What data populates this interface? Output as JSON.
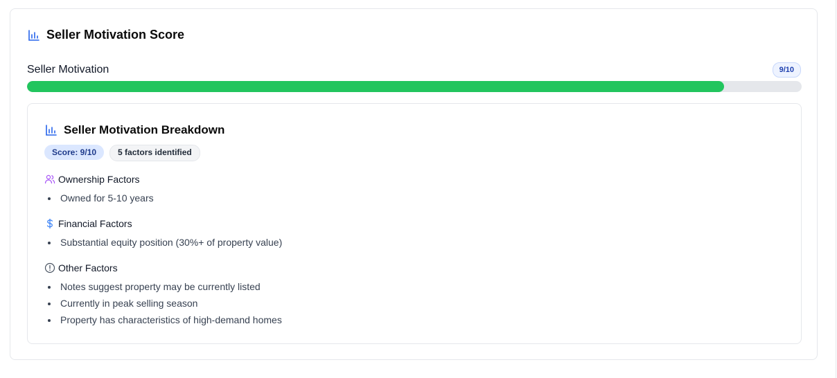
{
  "card": {
    "title": "Seller Motivation Score",
    "icon": "bar-chart-icon"
  },
  "meter": {
    "label": "Seller Motivation",
    "badge": "9/10",
    "value": 9,
    "max": 10,
    "fill_color": "#22c55e"
  },
  "breakdown": {
    "title": "Seller Motivation Breakdown",
    "score_pill": "Score: 9/10",
    "factors_pill": "5 factors identified",
    "sections": [
      {
        "title": "Ownership Factors",
        "icon": "users-icon",
        "items": [
          "Owned for 5-10 years"
        ]
      },
      {
        "title": "Financial Factors",
        "icon": "dollar-icon",
        "items": [
          "Substantial equity position (30%+ of property value)"
        ]
      },
      {
        "title": "Other Factors",
        "icon": "alert-circle-icon",
        "items": [
          "Notes suggest property may be currently listed",
          "Currently in peak selling season",
          "Property has characteristics of high-demand homes"
        ]
      }
    ]
  },
  "colors": {
    "accent_blue": "#2563eb",
    "progress_green": "#22c55e",
    "users_icon": "#a855f7",
    "dollar_icon": "#3b82f6",
    "alert_icon": "#4b5563"
  }
}
